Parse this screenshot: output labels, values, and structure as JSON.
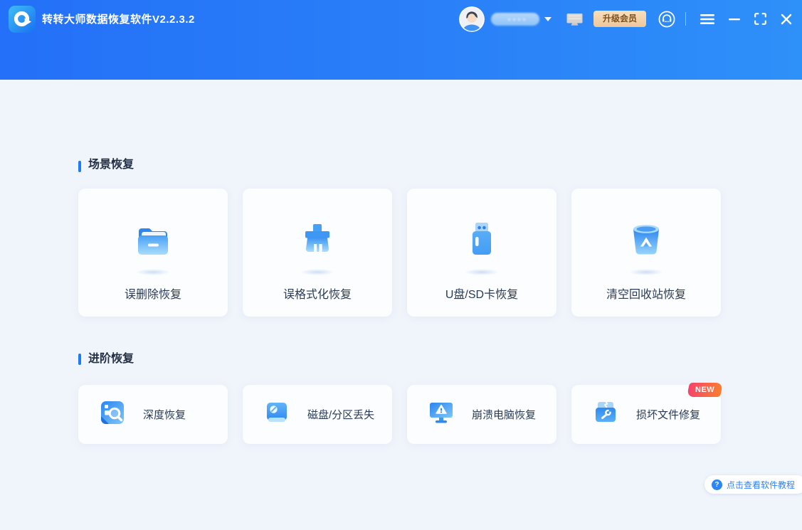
{
  "titlebar": {
    "app_title": "转转大师数据恢复软件V2.2.3.2",
    "upgrade_label": "升级会员"
  },
  "sections": {
    "scene": {
      "title": "场景恢复",
      "cards": [
        {
          "label": "误删除恢复",
          "icon": "folder-icon"
        },
        {
          "label": "误格式化恢复",
          "icon": "brush-icon"
        },
        {
          "label": "U盘/SD卡恢复",
          "icon": "usb-drive-icon"
        },
        {
          "label": "清空回收站恢复",
          "icon": "recycle-bin-icon"
        }
      ]
    },
    "advanced": {
      "title": "进阶恢复",
      "cards": [
        {
          "label": "深度恢复",
          "icon": "deep-scan-magnifier-icon"
        },
        {
          "label": "磁盘/分区丢失",
          "icon": "disk-error-icon"
        },
        {
          "label": "崩溃电脑恢复",
          "icon": "crashed-monitor-icon"
        },
        {
          "label": "损坏文件修复",
          "icon": "broken-file-wrench-icon",
          "badge": "NEW"
        }
      ]
    }
  },
  "tutorial": {
    "label": "点击查看软件教程"
  },
  "icons": {
    "logo": "circular-arrow-logo",
    "user_dropdown": "chevron-down",
    "screen_device": "monitor",
    "customer_service": "headset",
    "menu": "hamburger",
    "minimize": "minus",
    "maximize": "fullscreen-corners",
    "close": "x",
    "tutorial": "question-mark"
  },
  "colors": {
    "header_gradient_start": "#2470f8",
    "header_gradient_end": "#2e90f9",
    "content_background": "#f0f4fb",
    "accent_blue": "#1f7bf4",
    "card_background": "#fbfdff",
    "label_text": "#2a3a55",
    "upgrade_bg_start": "#f8dfbd",
    "upgrade_bg_end": "#eec79b",
    "upgrade_text": "#7c4f1e",
    "badge_gradient_start": "#f4436c",
    "badge_gradient_end": "#fb7e2e",
    "tutorial_text": "#2e81f7"
  }
}
